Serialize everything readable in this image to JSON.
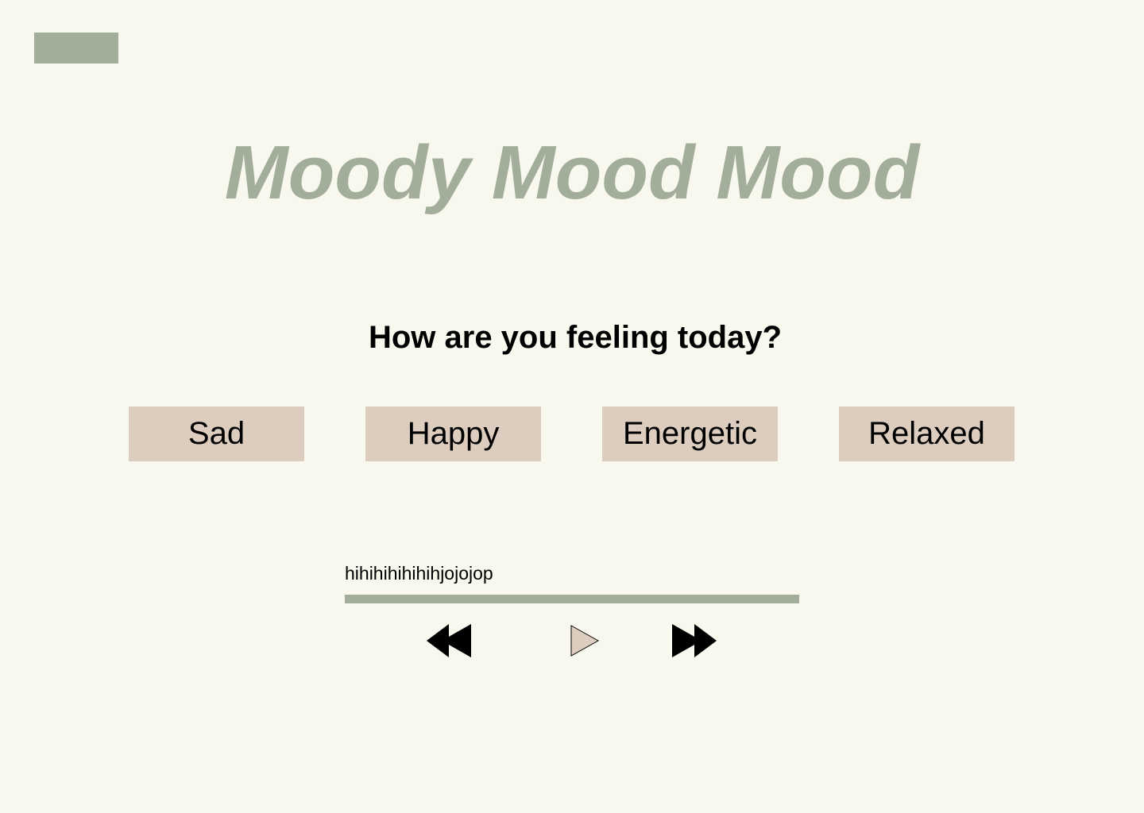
{
  "app": {
    "title": "Moody Mood Mood"
  },
  "prompt": {
    "question": "How are you feeling today?"
  },
  "moods": [
    {
      "label": "Sad"
    },
    {
      "label": "Happy"
    },
    {
      "label": "Energetic"
    },
    {
      "label": "Relaxed"
    }
  ],
  "player": {
    "track_name": "hihihihihihihjojojop",
    "progress_percent": 100,
    "controls": {
      "rewind_icon": "rewind-icon",
      "play_icon": "play-icon",
      "forward_icon": "fast-forward-icon"
    }
  },
  "colors": {
    "background": "#f8f8ee",
    "accent_green": "#a3ae9a",
    "button_beige": "#dccdbf",
    "text": "#000000"
  }
}
